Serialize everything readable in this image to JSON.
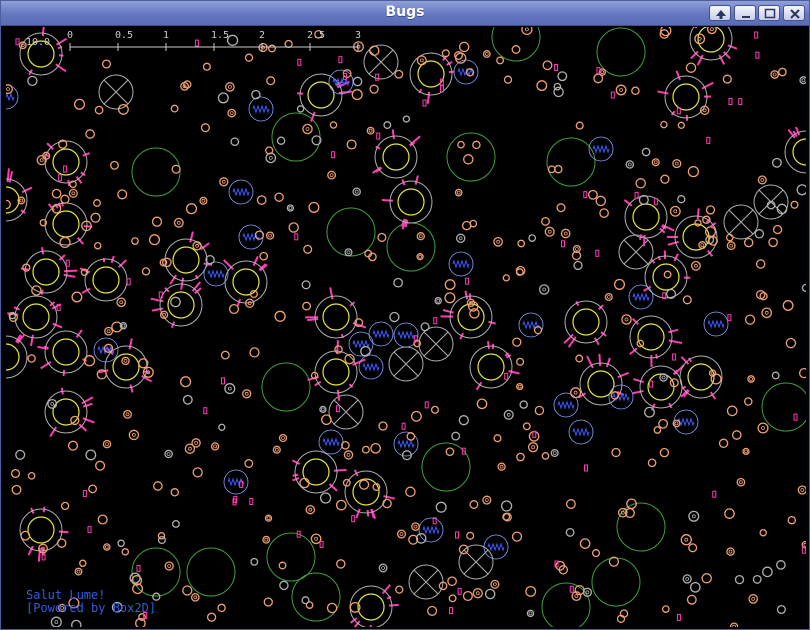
{
  "window": {
    "title": "Bugs",
    "buttons": [
      "up-arrow",
      "minimize",
      "maximize",
      "close"
    ]
  },
  "hud": {
    "fps": "10.0",
    "scale_labels": [
      "0",
      "0.5",
      "1",
      "1.5",
      "2",
      "2.5",
      "3"
    ],
    "message": "Salut Lume!",
    "powered_by": "[Powered by Box2D]"
  },
  "colors": {
    "background": "#000000",
    "green_ring": "#3fa03f",
    "yellow_ring": "#e6e640",
    "orange_ring": "#f0a070",
    "pink_mark": "#ff3cb4",
    "blue_coil": "#3c5aff",
    "grey_ring": "#b0b0b0",
    "hud_text": "#2f5ee0"
  }
}
